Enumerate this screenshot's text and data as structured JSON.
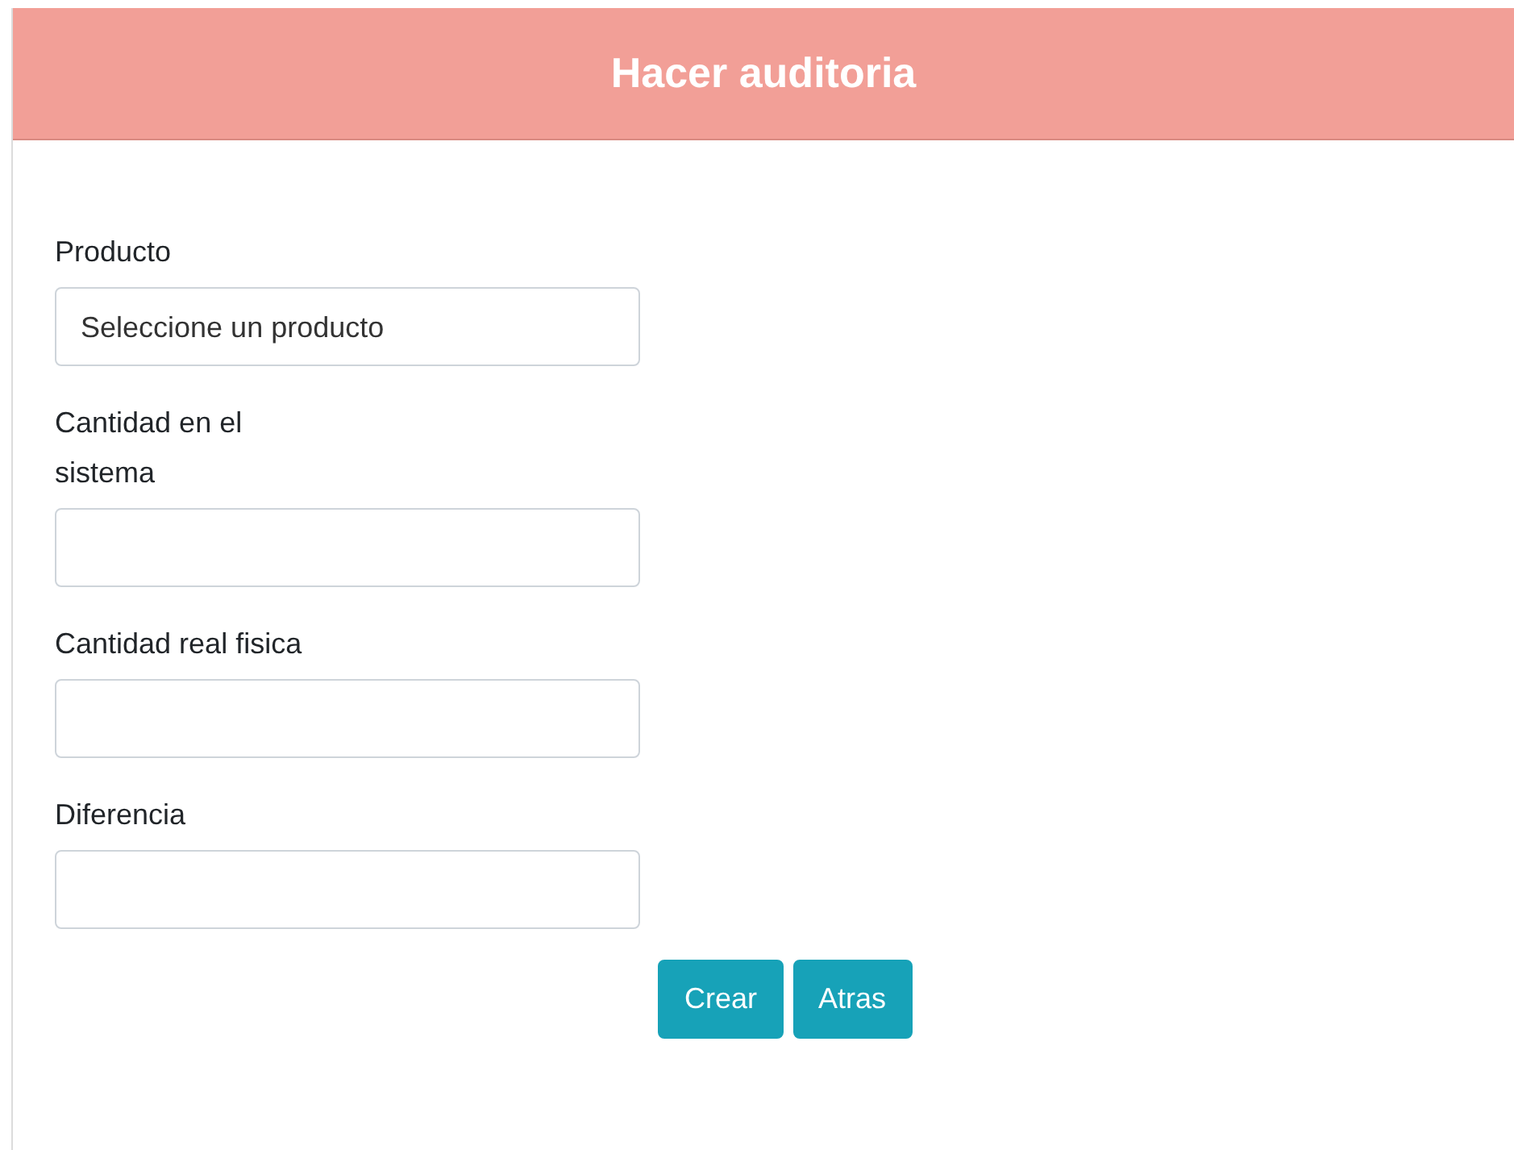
{
  "header": {
    "title": "Hacer auditoria"
  },
  "fields": [
    {
      "label": "Producto",
      "kind": "select",
      "value": "Seleccione un producto"
    },
    {
      "label": "Cantidad en el sistema",
      "kind": "input"
    },
    {
      "label": "Cantidad real fisica",
      "kind": "input"
    },
    {
      "label": "Diferencia",
      "kind": "input"
    }
  ],
  "buttons": [
    "Crear",
    "Atras"
  ]
}
